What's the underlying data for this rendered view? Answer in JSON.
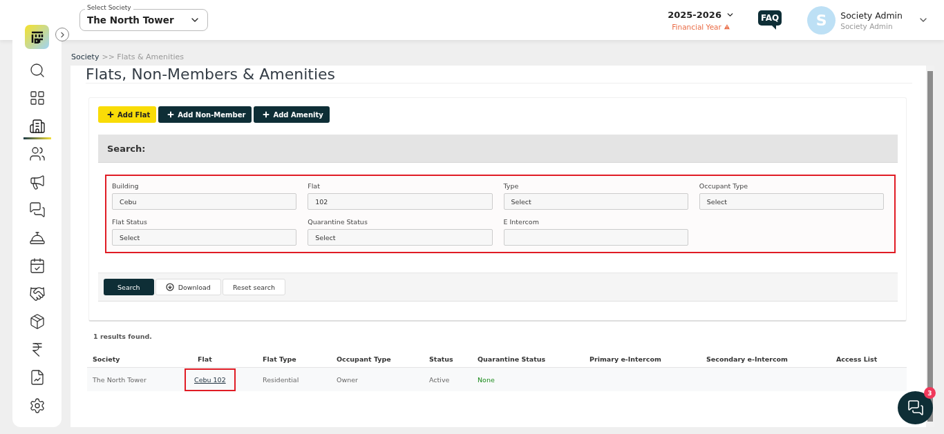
{
  "header": {
    "society_select": {
      "label": "Select Society",
      "value": "The North Tower"
    },
    "year": {
      "value": "2025-2026",
      "caption": "Financial Year"
    },
    "faq": "FAQ",
    "user": {
      "initial": "S",
      "name": "Society Admin",
      "role": "Society Admin"
    }
  },
  "sidebar": {
    "items": [
      {
        "kind": "search",
        "selected": false
      },
      {
        "kind": "dashboard",
        "selected": false
      },
      {
        "kind": "building",
        "selected": true
      },
      {
        "kind": "people",
        "selected": false
      },
      {
        "kind": "megaphone",
        "selected": false
      },
      {
        "kind": "chat",
        "selected": false
      },
      {
        "kind": "desk",
        "selected": false
      },
      {
        "kind": "calendar",
        "selected": false
      },
      {
        "kind": "handshake",
        "selected": false
      },
      {
        "kind": "box",
        "selected": false
      },
      {
        "kind": "rupee",
        "selected": false
      },
      {
        "kind": "report",
        "selected": false
      },
      {
        "kind": "settings",
        "selected": false
      }
    ]
  },
  "breadcrumb": {
    "root": "Society",
    "current": ">> Flats & Amenities"
  },
  "title": "Flats, Non-Members & Amenities",
  "actions": [
    {
      "label": "Add Flat",
      "kind": "primary"
    },
    {
      "label": "Add Non-Member",
      "kind": "dark"
    },
    {
      "label": "Add Amenity",
      "kind": "dark"
    }
  ],
  "search": {
    "heading": "Search:",
    "highlighted": true,
    "fields": [
      {
        "label": "Building",
        "value": "Cebu"
      },
      {
        "label": "Flat",
        "value": "102"
      },
      {
        "label": "Type",
        "value": "Select"
      },
      {
        "label": "Occupant Type",
        "value": "Select"
      },
      {
        "label": "Flat Status",
        "value": "Select"
      },
      {
        "label": "Quarantine Status",
        "value": "Select"
      },
      {
        "label": "E Intercom"
      }
    ],
    "buttons": [
      {
        "label": "Search",
        "kind": "dark"
      },
      {
        "label": "Download",
        "kind": "download"
      },
      {
        "label": "Reset search",
        "kind": "plain"
      }
    ]
  },
  "results": {
    "count": "1 results found.",
    "columns": [
      "Society",
      "Flat",
      "Flat Type",
      "Occupant Type",
      "Status",
      "Quarantine Status",
      "Primary e-Intercom",
      "Secondary e-Intercom",
      "Access List"
    ],
    "rows": [
      {
        "cells": [
          {
            "text": "The North Tower",
            "kind": "text",
            "highlighted": false
          },
          {
            "text": "Cebu 102",
            "kind": "link",
            "highlighted": true
          },
          {
            "text": "Residential",
            "kind": "text",
            "highlighted": false
          },
          {
            "text": "Owner",
            "kind": "text",
            "highlighted": false
          },
          {
            "text": "Active",
            "kind": "text",
            "highlighted": false
          },
          {
            "text": "None",
            "kind": "positive",
            "highlighted": false
          }
        ]
      }
    ]
  },
  "chat": {
    "badge": "3"
  }
}
